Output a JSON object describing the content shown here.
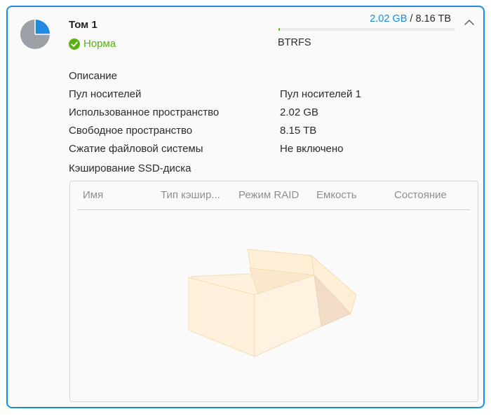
{
  "volume": {
    "title": "Том 1",
    "status": "Норма",
    "used": "2.02 GB",
    "separator": " / ",
    "total": "8.16 TB",
    "usage_fraction": 0.00025,
    "filesystem": "BTRFS",
    "icon": "volume-pie-icon"
  },
  "properties": [
    {
      "label": "Описание",
      "value": ""
    },
    {
      "label": "Пул носителей",
      "value": "Пул носителей 1"
    },
    {
      "label": "Использованное пространство",
      "value": "2.02 GB"
    },
    {
      "label": "Свободное пространство",
      "value": "8.15 TB"
    },
    {
      "label": "Сжатие файловой системы",
      "value": "Не включено"
    }
  ],
  "ssd_cache": {
    "title": "Кэширование SSD-диска",
    "columns": {
      "name": "Имя",
      "type": "Тип кэшир...",
      "raid": "Режим RAID",
      "capacity": "Емкость",
      "state": "Состояние"
    },
    "rows": [],
    "empty_icon": "empty-box-icon"
  },
  "colors": {
    "accent": "#1f8ae0",
    "ok": "#59b20f",
    "pie_used": "#1f8ae0",
    "pie_free": "#9aa0a6"
  }
}
